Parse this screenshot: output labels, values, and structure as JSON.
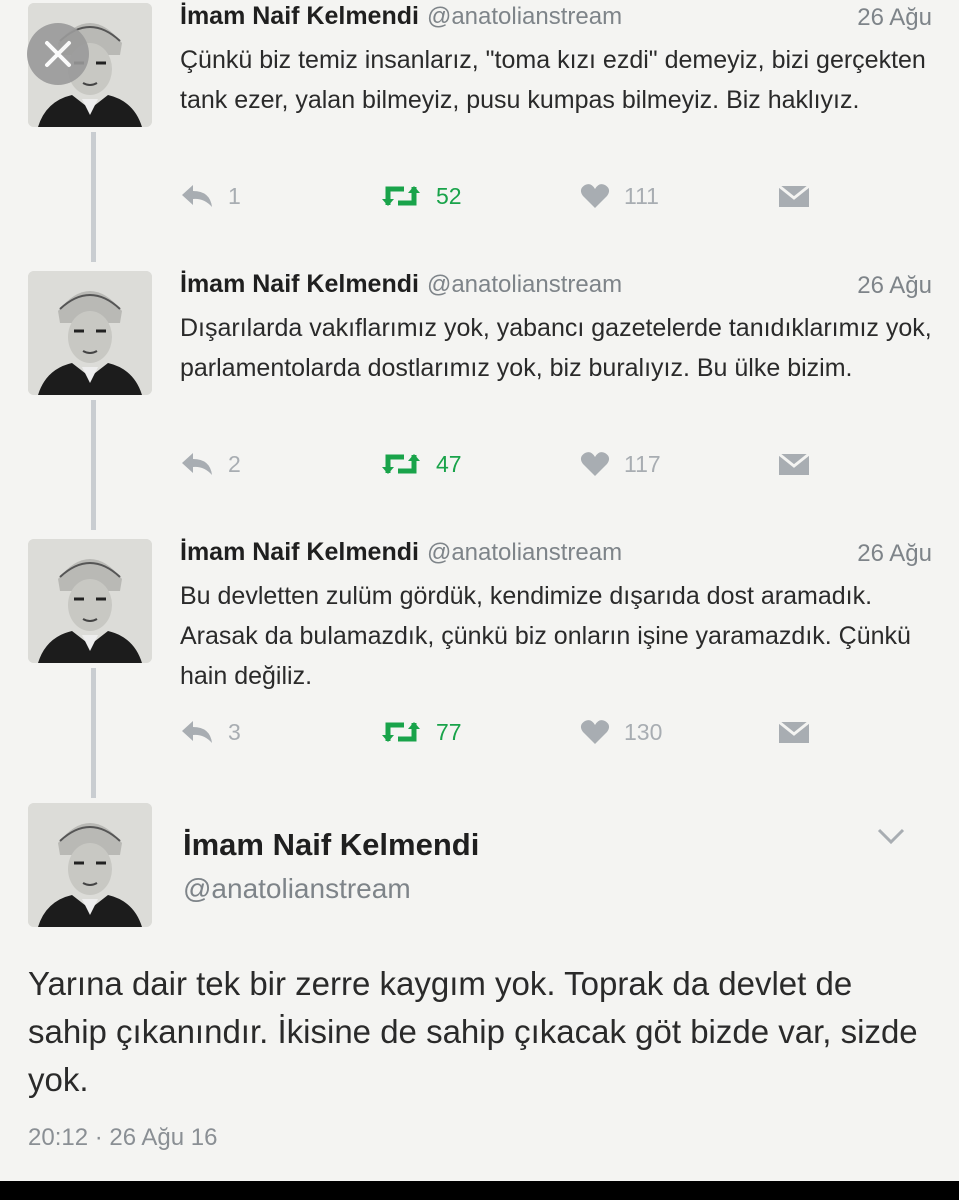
{
  "tweets": [
    {
      "name": "İmam Naif Kelmendi",
      "handle": "@anatolianstream",
      "date": "26 Ağu",
      "text": "Çünkü biz temiz insanlarız, \"toma kızı ezdi\" demeyiz, bizi gerçekten tank ezer, yalan bilmeyiz, pusu kumpas bilmeyiz. Biz haklıyız.",
      "replies": "1",
      "retweets": "52",
      "likes": "111"
    },
    {
      "name": "İmam Naif Kelmendi",
      "handle": "@anatolianstream",
      "date": "26 Ağu",
      "text": "Dışarılarda vakıflarımız yok, yabancı gazetelerde tanıdıklarımız yok, parlamentolarda dostlarımız yok, biz buralıyız. Bu ülke bizim.",
      "replies": "2",
      "retweets": "47",
      "likes": "117"
    },
    {
      "name": "İmam Naif Kelmendi",
      "handle": "@anatolianstream",
      "date": "26 Ağu",
      "text": "Bu devletten zulüm gördük, kendimize dışarıda dost aramadık. Arasak da bulamazdık, çünkü biz onların işine yaramazdık. Çünkü hain değiliz.",
      "replies": "3",
      "retweets": "77",
      "likes": "130"
    }
  ],
  "main_tweet": {
    "name": "İmam Naif Kelmendi",
    "handle": "@anatolianstream",
    "text": "Yarına dair tek bir zerre kaygım yok. Toprak da devlet de sahip çıkanındır. İkisine de sahip çıkacak göt bizde var, sizde yok.",
    "timestamp": "20:12 · 26 Ağu 16"
  },
  "icons": {
    "close": "close-icon",
    "reply": "reply-icon",
    "retweet": "retweet-icon",
    "like": "heart-icon",
    "message": "direct-message-icon",
    "chevron": "chevron-down-icon"
  },
  "colors": {
    "background": "#f4f4f2",
    "retweet_green": "#19a34a",
    "muted_gray": "#7e8489",
    "thread_line": "#c9cdd1"
  }
}
